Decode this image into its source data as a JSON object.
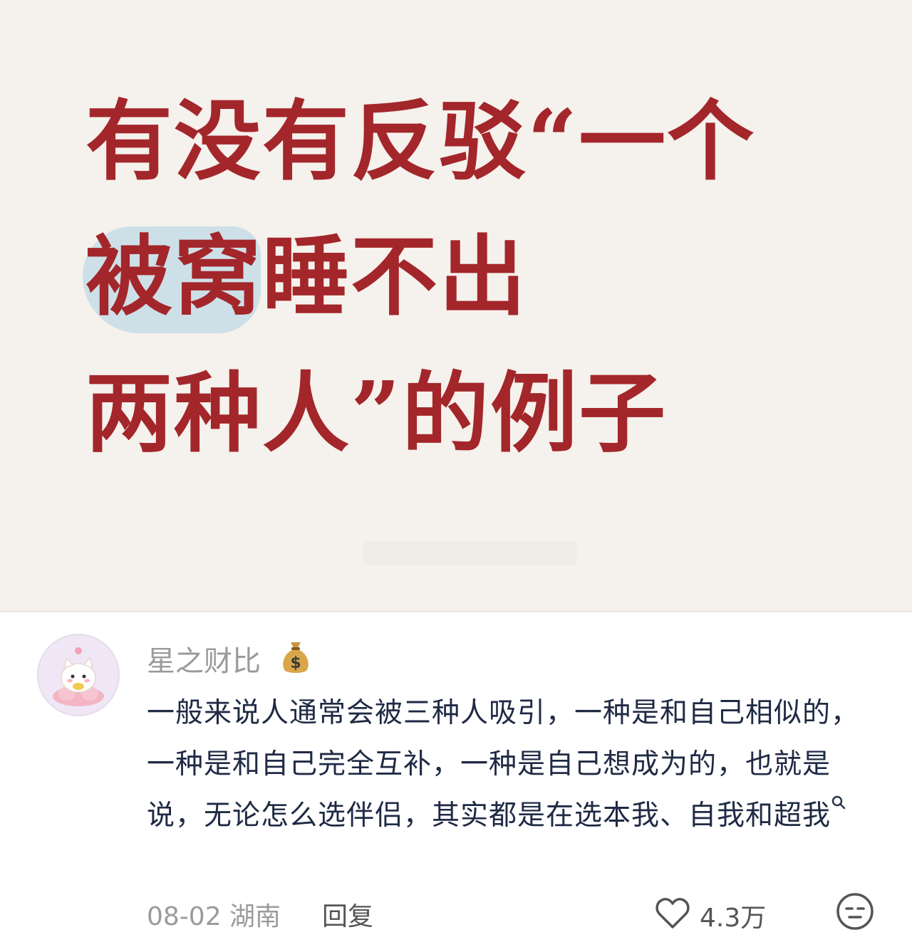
{
  "post": {
    "title_lines": [
      "有没有反驳“一个",
      "被窝睡不出",
      "两种人”的例子"
    ],
    "highlight_text": "被窝"
  },
  "comment": {
    "username": "星之财比",
    "badge_icon": "money-bag-icon",
    "text": "一般来说人通常会被三种人吸引，一种是和自己相似的，一种是和自己完全互补，一种是自己想成为的，也就是说，无论怎么选伴侣，其实都是在选本我、自我和超我",
    "date_location": "08-02 湖南",
    "reply_label": "回复",
    "like_count": "4.3万"
  },
  "colors": {
    "title": "#a3262b",
    "highlight": "#c6dde8",
    "comment_text": "#1f2a44",
    "muted": "#9b9b9b"
  }
}
